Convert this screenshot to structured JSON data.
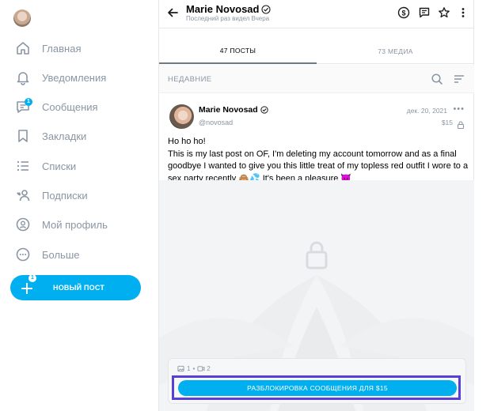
{
  "sidebar": {
    "items": [
      {
        "label": "Главная",
        "icon": "home-icon"
      },
      {
        "label": "Уведомления",
        "icon": "bell-icon"
      },
      {
        "label": "Сообщения",
        "icon": "chat-icon",
        "badge": "1"
      },
      {
        "label": "Закладки",
        "icon": "bookmark-icon"
      },
      {
        "label": "Списки",
        "icon": "list-icon"
      },
      {
        "label": "Подписки",
        "icon": "subscriptions-icon"
      },
      {
        "label": "Мой профиль",
        "icon": "profile-icon"
      },
      {
        "label": "Больше",
        "icon": "more-icon"
      }
    ],
    "new_post": {
      "label": "НОВЫЙ ПОСТ",
      "badge": "1"
    }
  },
  "header": {
    "name": "Marie Novosad",
    "last_seen": "Последний раз видел Вчера"
  },
  "tabs": [
    {
      "label": "47 ПОСТЫ",
      "active": true
    },
    {
      "label": "73 МЕДИА",
      "active": false
    }
  ],
  "feed": {
    "section_label": "НЕДАВНИЕ"
  },
  "post": {
    "author": "Marie Novosad",
    "handle": "@novosad",
    "date": "дек. 20, 2021",
    "price": "$15",
    "text_line1": "Ho ho ho!",
    "text_body": "This is my last post on OF, I'm deleting my account tomorrow and as a final goodbye I wanted to give you this little treat of my topless red outfit I wore to a sex party recently 🙈💦 It's been a pleasure 😈",
    "media_photos": "1",
    "media_videos": "2",
    "unlock_label": "РАЗБЛОКИРОВКА СООБЩЕНИЯ ДЛЯ $15"
  },
  "colors": {
    "accent": "#00aff0",
    "muted_text": "#8a96a3",
    "highlight_frame": "#5a3fd6"
  }
}
